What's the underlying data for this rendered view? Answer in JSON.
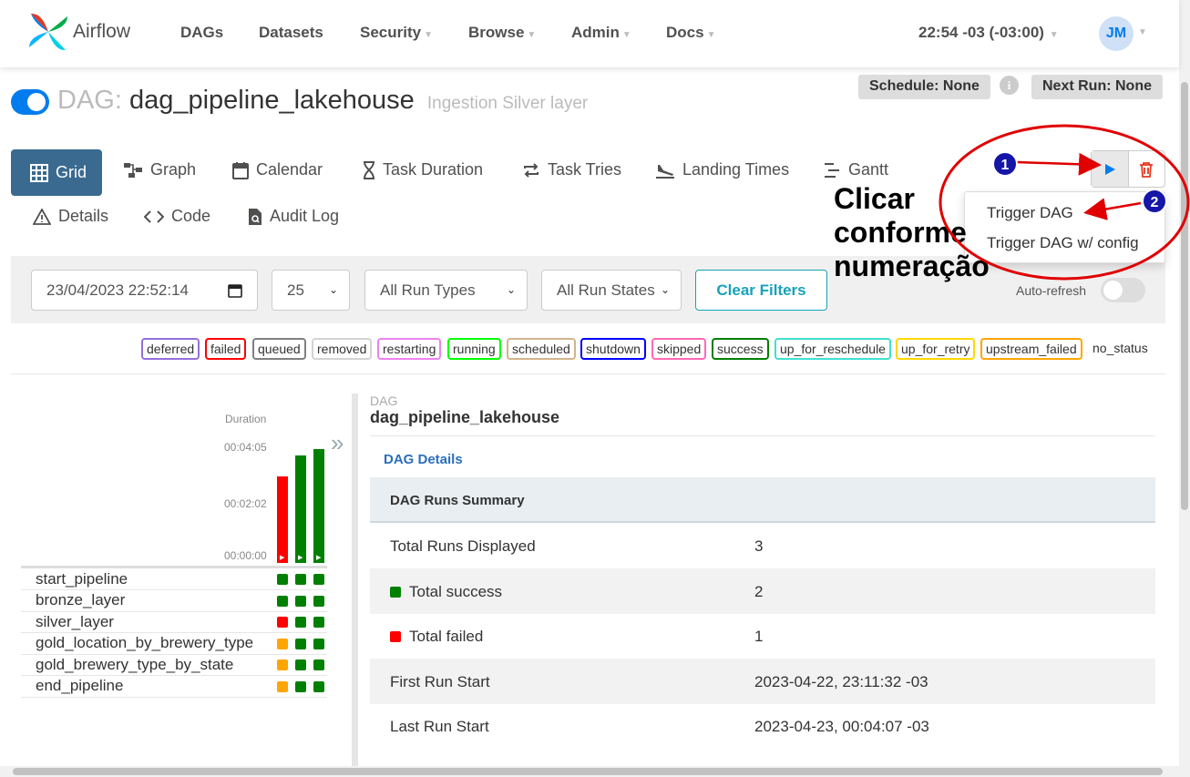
{
  "navbar": {
    "brand": "Airflow",
    "items": [
      {
        "label": "DAGs",
        "has_caret": false
      },
      {
        "label": "Datasets",
        "has_caret": false
      },
      {
        "label": "Security",
        "has_caret": true
      },
      {
        "label": "Browse",
        "has_caret": true
      },
      {
        "label": "Admin",
        "has_caret": true
      },
      {
        "label": "Docs",
        "has_caret": true
      }
    ],
    "time": "22:54 -03 (-03:00)",
    "user_initials": "JM"
  },
  "dag": {
    "prefix": "DAG:",
    "id": "dag_pipeline_lakehouse",
    "description": "Ingestion Silver layer",
    "paused": false,
    "schedule": "Schedule: None",
    "next_run": "Next Run: None",
    "info_icon": "info-icon"
  },
  "tabs": [
    {
      "label": "Grid",
      "icon": "grid-icon",
      "active": true
    },
    {
      "label": "Graph",
      "icon": "graph-icon"
    },
    {
      "label": "Calendar",
      "icon": "calendar-icon"
    },
    {
      "label": "Task Duration",
      "icon": "hourglass-icon"
    },
    {
      "label": "Task Tries",
      "icon": "repeat-icon"
    },
    {
      "label": "Landing Times",
      "icon": "plane-landing-icon"
    },
    {
      "label": "Gantt",
      "icon": "gantt-icon"
    },
    {
      "label": "Details",
      "icon": "warning-triangle-icon"
    },
    {
      "label": "Code",
      "icon": "code-icon"
    },
    {
      "label": "Audit Log",
      "icon": "file-search-icon"
    }
  ],
  "actions": {
    "trigger_menu": [
      "Trigger DAG",
      "Trigger DAG w/ config"
    ]
  },
  "annotation": {
    "lines": [
      "Clicar",
      "conforme",
      "numeração"
    ],
    "markers": [
      "1",
      "2"
    ]
  },
  "filters": {
    "date": "23/04/2023 22:52:14",
    "num_runs": "25",
    "run_type": "All Run Types",
    "run_state": "All Run States",
    "clear_label": "Clear Filters",
    "auto_refresh_label": "Auto-refresh",
    "auto_refresh_on": false
  },
  "legend": [
    {
      "label": "deferred",
      "color": "#9370db"
    },
    {
      "label": "failed",
      "color": "#ff0000"
    },
    {
      "label": "queued",
      "color": "#808080"
    },
    {
      "label": "removed",
      "color": "#d3d3d3"
    },
    {
      "label": "restarting",
      "color": "#ee82ee"
    },
    {
      "label": "running",
      "color": "#00ff00"
    },
    {
      "label": "scheduled",
      "color": "#d2b48c"
    },
    {
      "label": "shutdown",
      "color": "#0000ff"
    },
    {
      "label": "skipped",
      "color": "#ff69b4"
    },
    {
      "label": "success",
      "color": "#008000"
    },
    {
      "label": "up_for_reschedule",
      "color": "#40e0d0"
    },
    {
      "label": "up_for_retry",
      "color": "#ffd700"
    },
    {
      "label": "upstream_failed",
      "color": "#ffa500"
    },
    {
      "label": "no_status",
      "color": null
    }
  ],
  "grid": {
    "duration_label": "Duration",
    "y_ticks": [
      "00:04:05",
      "00:02:02",
      "00:00:00"
    ],
    "runs": [
      {
        "duration_fraction": 0.76,
        "state": "failed"
      },
      {
        "duration_fraction": 0.94,
        "state": "success"
      },
      {
        "duration_fraction": 1.0,
        "state": "success"
      }
    ],
    "tasks": [
      {
        "name": "start_pipeline",
        "states": [
          "success",
          "success",
          "success"
        ]
      },
      {
        "name": "bronze_layer",
        "states": [
          "success",
          "success",
          "success"
        ]
      },
      {
        "name": "silver_layer",
        "states": [
          "failed",
          "success",
          "success"
        ]
      },
      {
        "name": "gold_location_by_brewery_type",
        "states": [
          "upstream_failed",
          "success",
          "success"
        ]
      },
      {
        "name": "gold_brewery_type_by_state",
        "states": [
          "upstream_failed",
          "success",
          "success"
        ]
      },
      {
        "name": "end_pipeline",
        "states": [
          "upstream_failed",
          "success",
          "success"
        ]
      }
    ]
  },
  "details": {
    "label": "DAG",
    "name": "dag_pipeline_lakehouse",
    "link": "DAG Details",
    "summary_title": "DAG Runs Summary",
    "rows": [
      {
        "key": "Total Runs Displayed",
        "value": "3",
        "dot": null
      },
      {
        "key": "Total success",
        "value": "2",
        "dot": "#008000"
      },
      {
        "key": "Total failed",
        "value": "1",
        "dot": "#ff0000"
      },
      {
        "key": "First Run Start",
        "value": "2023-04-22, 23:11:32 -03",
        "dot": null
      },
      {
        "key": "Last Run Start",
        "value": "2023-04-23, 00:04:07 -03",
        "dot": null
      }
    ]
  }
}
